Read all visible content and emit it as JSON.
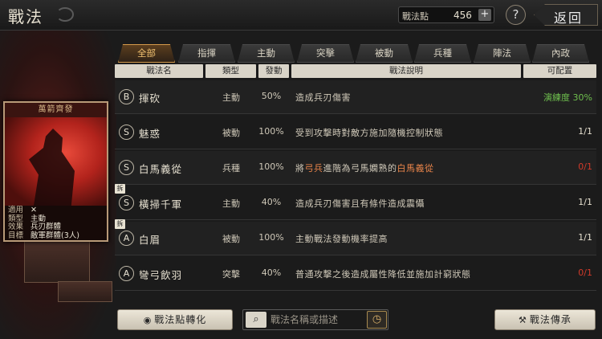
{
  "header": {
    "title": "戰法",
    "points_label": "戰法點",
    "points_value": "456",
    "plus_label": "+",
    "help_label": "?",
    "back_label": "返回"
  },
  "card": {
    "title": "萬箭齊發",
    "info": [
      {
        "key": "適用",
        "value": "✕"
      },
      {
        "key": "類型",
        "value": "主動"
      },
      {
        "key": "效果",
        "value": "兵刃群體"
      },
      {
        "key": "目標",
        "value": "敵軍群體(3人)"
      }
    ]
  },
  "tabs": [
    "全部",
    "指揮",
    "主動",
    "突擊",
    "被動",
    "兵種",
    "陣法",
    "內政"
  ],
  "active_tab": "全部",
  "columns": {
    "name": "戰法名",
    "type": "類型",
    "rate": "發動",
    "desc": "戰法說明",
    "avail": "可配置"
  },
  "rows": [
    {
      "grade": "B",
      "name": "揮砍",
      "type": "主動",
      "rate": "50%",
      "desc": "造成兵刃傷害",
      "avail": "演練度 30%",
      "avail_color": "#6fc04e",
      "tag": ""
    },
    {
      "grade": "S",
      "name": "魅惑",
      "type": "被動",
      "rate": "100%",
      "desc": "受到攻擊時對敵方施加隨機控制狀態",
      "avail": "1/1",
      "avail_color": "#e6e0d0",
      "tag": ""
    },
    {
      "grade": "S",
      "name": "白馬義從",
      "type": "兵種",
      "rate": "100%",
      "desc_parts": [
        "將",
        "弓兵",
        "進階為弓馬嫻熟的",
        "白馬義從"
      ],
      "avail": "0/1",
      "avail_color": "#d23a2a",
      "tag": ""
    },
    {
      "grade": "S",
      "name": "橫掃千軍",
      "type": "主動",
      "rate": "40%",
      "desc": "造成兵刃傷害且有條件造成震懾",
      "avail": "1/1",
      "avail_color": "#e6e0d0",
      "tag": "拆"
    },
    {
      "grade": "A",
      "name": "白眉",
      "type": "被動",
      "rate": "100%",
      "desc": "主動戰法發動機率提高",
      "avail": "1/1",
      "avail_color": "#e6e0d0",
      "tag": "拆"
    },
    {
      "grade": "A",
      "name": "彎弓飲羽",
      "type": "突擊",
      "rate": "40%",
      "desc": "普通攻擊之後造成屬性降低並施加計窮狀態",
      "avail": "0/1",
      "avail_color": "#d23a2a",
      "tag": ""
    }
  ],
  "bottom": {
    "convert_label": "戰法點轉化",
    "search_placeholder": "戰法名稱或描述",
    "inherit_label": "戰法傳承"
  }
}
